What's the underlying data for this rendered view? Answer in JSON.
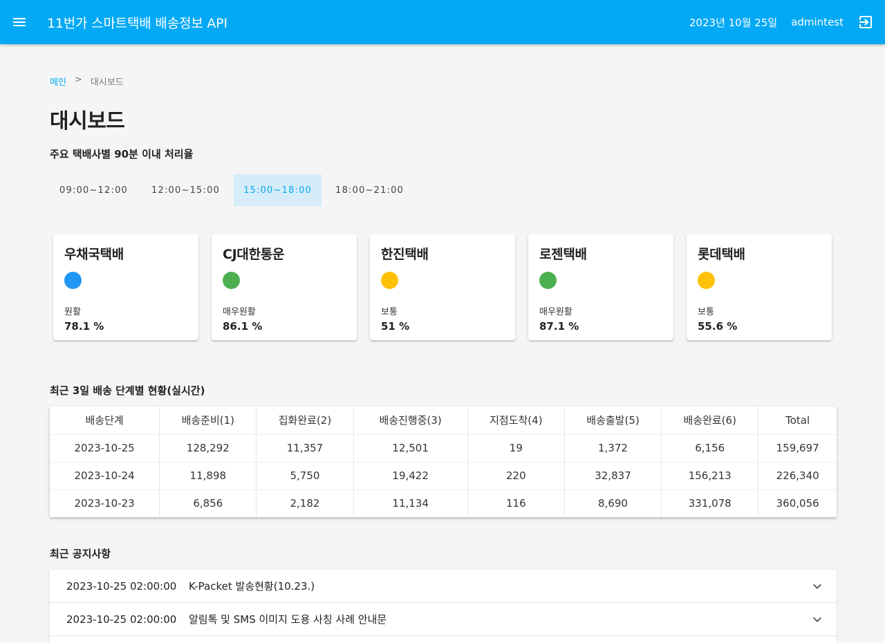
{
  "header": {
    "title": "11번가 스마트택배 배송정보 API",
    "date": "2023년 10월 25일",
    "user": "admintest"
  },
  "breadcrumb": {
    "home": "메인",
    "separator": ">",
    "current": "대시보드"
  },
  "page_title": "대시보드",
  "rate_section": {
    "title": "주요 택배사별 90분 이내 처리율",
    "tabs": [
      {
        "label": "09:00~12:00"
      },
      {
        "label": "12:00~15:00"
      },
      {
        "label": "15:00~18:00",
        "active": true
      },
      {
        "label": "18:00~21:00"
      }
    ]
  },
  "carriers": [
    {
      "name": "우채국택배",
      "status": "원활",
      "rate": "78.1 %",
      "color": "#2196f3"
    },
    {
      "name": "CJ대한통운",
      "status": "매우원활",
      "rate": "86.1 %",
      "color": "#4caf50"
    },
    {
      "name": "한진택배",
      "status": "보통",
      "rate": "51 %",
      "color": "#ffc107"
    },
    {
      "name": "로젠택배",
      "status": "매우원활",
      "rate": "87.1 %",
      "color": "#4caf50"
    },
    {
      "name": "롯데택배",
      "status": "보통",
      "rate": "55.6 %",
      "color": "#ffc107"
    }
  ],
  "delivery_section": {
    "title": "최근 3일 배송 단계별 현황(실시간)",
    "columns": [
      "배송단계",
      "배송준비(1)",
      "집화완료(2)",
      "배송진행중(3)",
      "지점도착(4)",
      "배송출발(5)",
      "배송완료(6)",
      "Total"
    ],
    "rows": [
      [
        "2023-10-25",
        "128,292",
        "11,357",
        "12,501",
        "19",
        "1,372",
        "6,156",
        "159,697"
      ],
      [
        "2023-10-24",
        "11,898",
        "5,750",
        "19,422",
        "220",
        "32,837",
        "156,213",
        "226,340"
      ],
      [
        "2023-10-23",
        "6,856",
        "2,182",
        "11,134",
        "116",
        "8,690",
        "331,078",
        "360,056"
      ]
    ]
  },
  "notice_section": {
    "title": "최근 공지사항",
    "items": [
      {
        "date": "2023-10-25 02:00:00",
        "title": "K-Packet 발송현황(10.23.)"
      },
      {
        "date": "2023-10-25 02:00:00",
        "title": "알림톡 및 SMS 이미지 도용 사칭 사례 안내문"
      },
      {
        "date": "",
        "title": ""
      }
    ]
  },
  "colors": {
    "accent": "#03a9f4",
    "tab_active_bg": "#d6ecf9"
  },
  "icons": {
    "menu": "menu-icon",
    "logout": "logout-icon",
    "expand": "chevron-down-icon"
  }
}
